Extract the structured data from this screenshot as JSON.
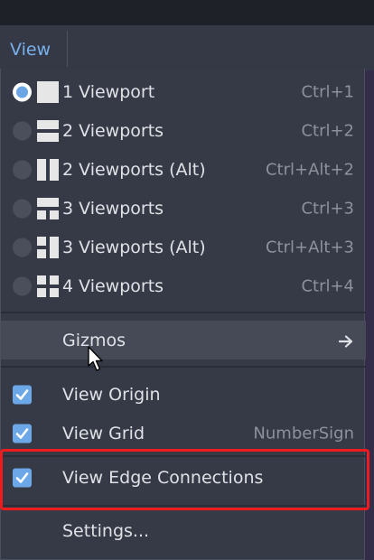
{
  "menubar": {
    "view_label": "View"
  },
  "view_menu": {
    "viewports": [
      {
        "label": "1 Viewport",
        "shortcut": "Ctrl+1",
        "selected": true,
        "icon": "one-viewport-icon"
      },
      {
        "label": "2 Viewports",
        "shortcut": "Ctrl+2",
        "selected": false,
        "icon": "two-viewports-icon"
      },
      {
        "label": "2 Viewports (Alt)",
        "shortcut": "Ctrl+Alt+2",
        "selected": false,
        "icon": "two-viewports-alt-icon"
      },
      {
        "label": "3 Viewports",
        "shortcut": "Ctrl+3",
        "selected": false,
        "icon": "three-viewports-icon"
      },
      {
        "label": "3 Viewports (Alt)",
        "shortcut": "Ctrl+Alt+3",
        "selected": false,
        "icon": "three-viewports-alt-icon"
      },
      {
        "label": "4 Viewports",
        "shortcut": "Ctrl+4",
        "selected": false,
        "icon": "four-viewports-icon"
      }
    ],
    "gizmos": {
      "label": "Gizmos",
      "icon": "arrow-right-icon"
    },
    "toggles": [
      {
        "label": "View Origin",
        "shortcut": "",
        "checked": true
      },
      {
        "label": "View Grid",
        "shortcut": "NumberSign",
        "checked": true
      },
      {
        "label": "View Edge Connections",
        "shortcut": "",
        "checked": true,
        "highlighted": true
      }
    ],
    "settings": {
      "label": "Settings..."
    }
  },
  "colors": {
    "accent": "#6ca8e8",
    "menu_bg": "#363a46",
    "hover_bg": "#464a57",
    "highlight_border": "#ee1c1c"
  }
}
